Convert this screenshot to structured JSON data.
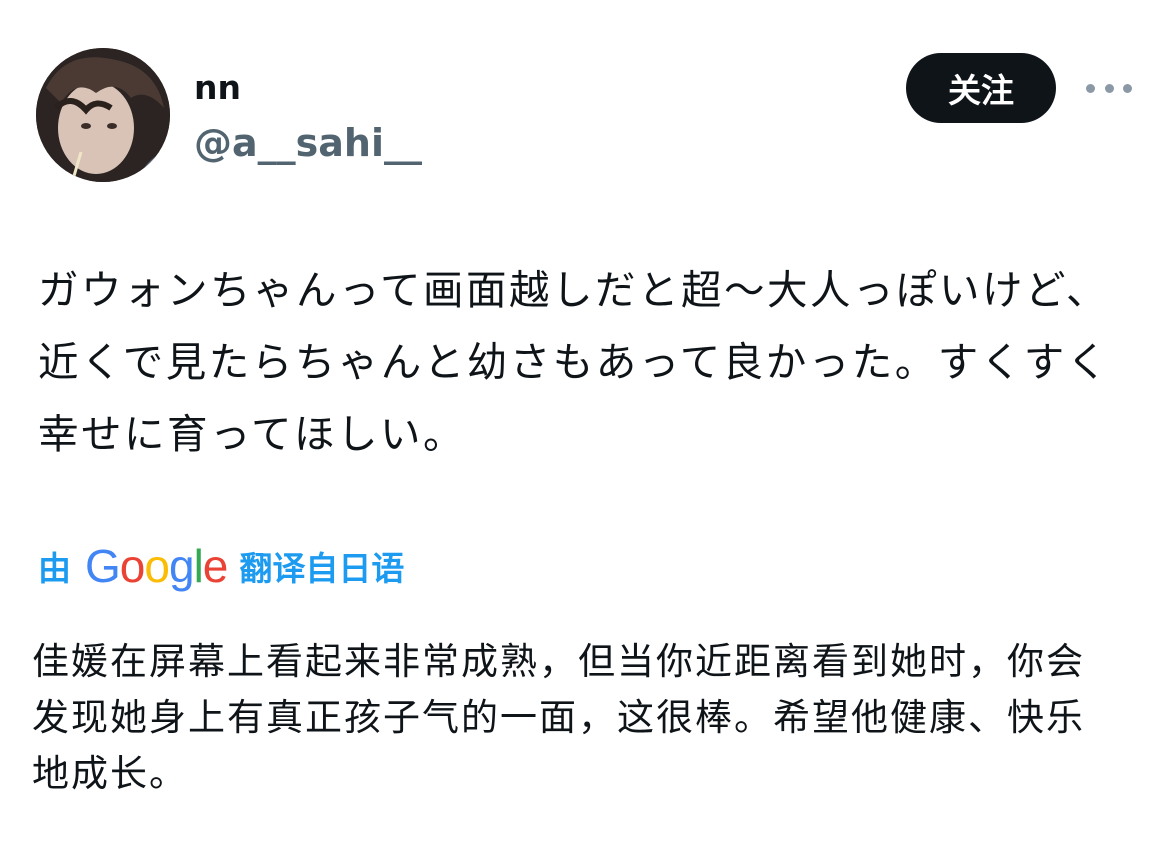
{
  "author": {
    "display_name": "nn",
    "handle": "@a__sahi__",
    "avatar_icon": "user-avatar-photo"
  },
  "actions": {
    "follow_label": "关注",
    "more_icon": "more-horizontal-icon"
  },
  "tweet": {
    "original_text": "ガウォンちゃんって画面越しだと超〜大人っぽいけど、近くで見たらちゃんと幼さもあって良かった。すくすく幸せに育ってほしい。",
    "translation": {
      "prefix": "由",
      "provider_letters": [
        "G",
        "o",
        "o",
        "g",
        "l",
        "e"
      ],
      "suffix": "翻译自日语",
      "colors": {
        "blue": "#4285f4",
        "red": "#ea4335",
        "yellow": "#fbbc05",
        "green": "#34a853",
        "link": "#1d9bf0"
      }
    },
    "translated_text": "佳媛在屏幕上看起来非常成熟，但当你近距离看到她时，你会发现她身上有真正孩子气的一面，这很棒。希望他健康、快乐地成长。"
  },
  "colors": {
    "text_primary": "#0f1419",
    "text_secondary": "#536471",
    "button_bg": "#0f1419",
    "button_text": "#ffffff"
  }
}
